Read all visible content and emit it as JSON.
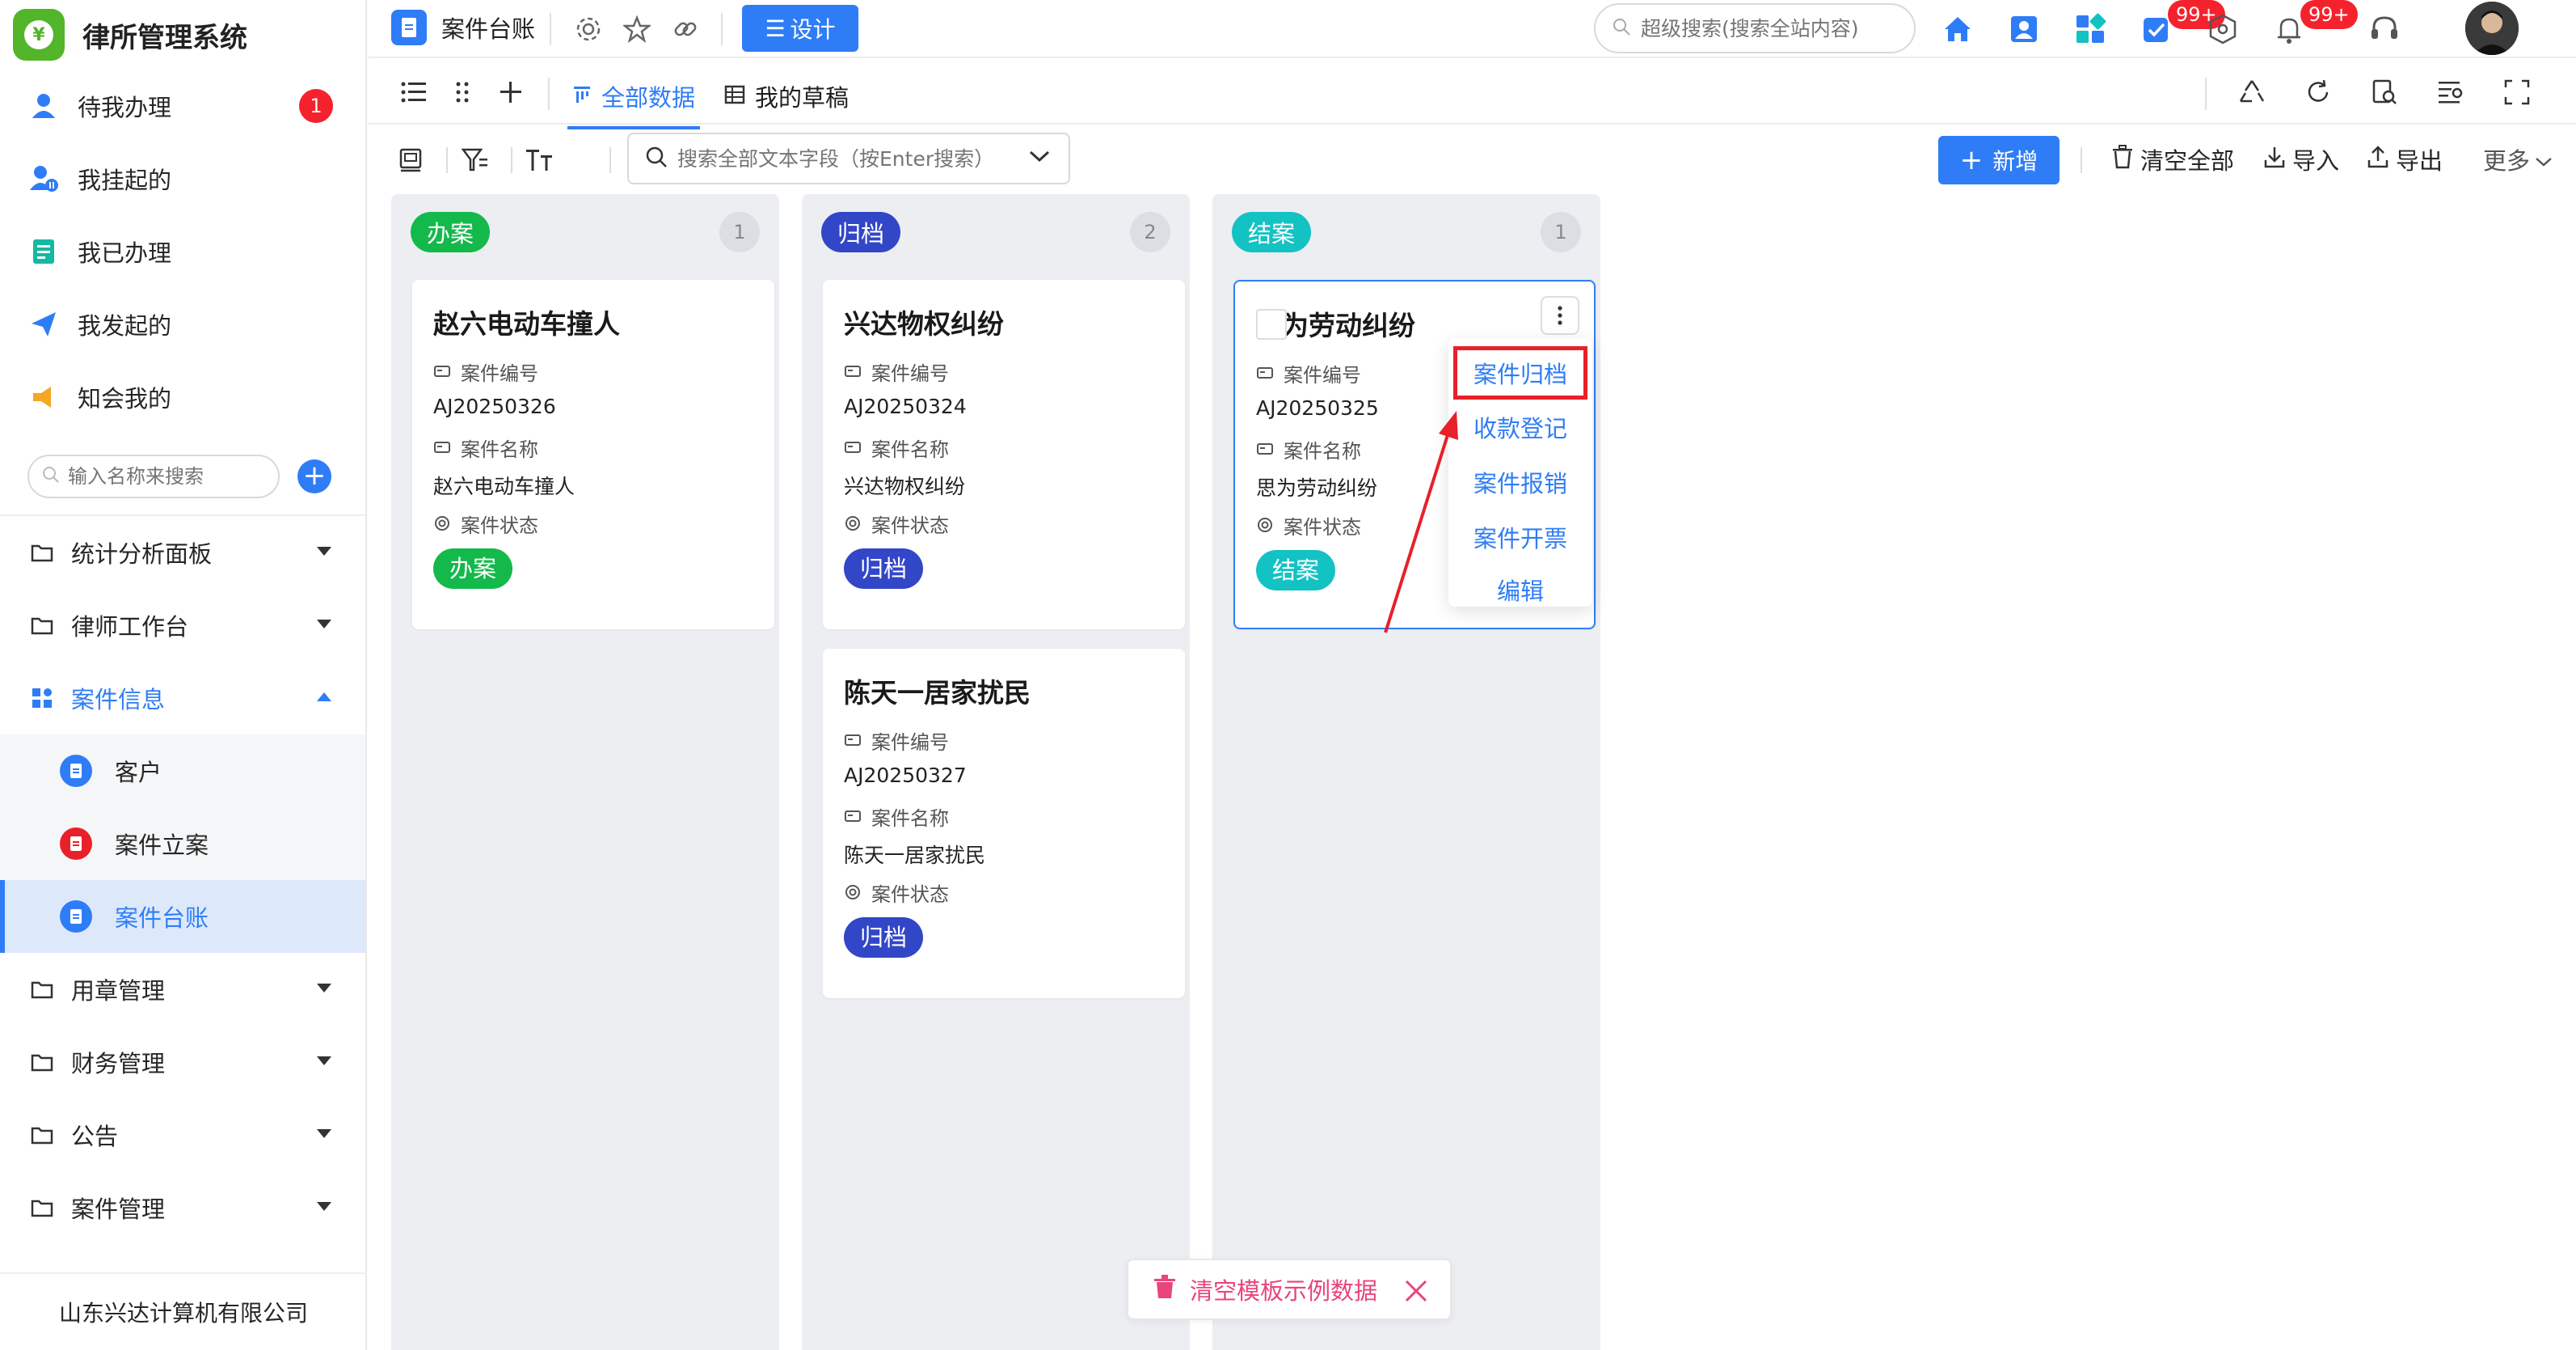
{
  "app": {
    "title": "律所管理系统",
    "company": "山东兴达计算机有限公司"
  },
  "sidebar": {
    "todo_items": [
      {
        "label": "待我办理",
        "icon": "user-task-icon",
        "badge": "1"
      },
      {
        "label": "我挂起的",
        "icon": "user-pause-icon"
      },
      {
        "label": "我已办理",
        "icon": "checklist-icon"
      },
      {
        "label": "我发起的",
        "icon": "paper-plane-icon"
      },
      {
        "label": "知会我的",
        "icon": "megaphone-icon"
      }
    ],
    "search_placeholder": "输入名称来搜索",
    "menus": [
      {
        "label": "统计分析面板",
        "icon": "folder-icon"
      },
      {
        "label": "律师工作台",
        "icon": "folder-icon"
      },
      {
        "label": "案件信息",
        "icon": "grid-icon",
        "expanded": true,
        "children": [
          {
            "label": "客户",
            "icon": "doc-blue-icon"
          },
          {
            "label": "案件立案",
            "icon": "doc-red-icon"
          },
          {
            "label": "案件台账",
            "icon": "doc-blue-icon",
            "active": true
          }
        ]
      },
      {
        "label": "用章管理",
        "icon": "folder-icon"
      },
      {
        "label": "财务管理",
        "icon": "folder-icon"
      },
      {
        "label": "公告",
        "icon": "folder-icon"
      },
      {
        "label": "案件管理",
        "icon": "folder-icon"
      }
    ]
  },
  "topbar": {
    "page_title": "案件台账",
    "design_label": "设计",
    "search_placeholder": "超级搜索(搜索全站内容)",
    "task_badge": "99+",
    "notify_badge": "99+"
  },
  "viewbar": {
    "tabs": [
      {
        "label": "全部数据",
        "active": true
      },
      {
        "label": "我的草稿",
        "active": false
      }
    ]
  },
  "toolbar": {
    "search_placeholder": "搜索全部文本字段（按Enter搜索）",
    "add_label": "新增",
    "clear_label": "清空全部",
    "import_label": "导入",
    "export_label": "导出",
    "more_label": "更多"
  },
  "colors": {
    "accent": "#2f7df6",
    "green": "#13b94a",
    "navy": "#3246c8",
    "teal": "#13c2c2",
    "red": "#e8202a"
  },
  "fields": {
    "case_no": "案件编号",
    "case_name": "案件名称",
    "case_status": "案件状态"
  },
  "columns": [
    {
      "tag": "办案",
      "count": "1",
      "color": "#13b94a",
      "cards": [
        {
          "title": "赵六电动车撞人",
          "case_no": "AJ20250326",
          "case_name": "赵六电动车撞人",
          "status": "办案"
        }
      ]
    },
    {
      "tag": "归档",
      "count": "2",
      "color": "#3246c8",
      "cards": [
        {
          "title": "兴达物权纠纷",
          "case_no": "AJ20250324",
          "case_name": "兴达物权纠纷",
          "status": "归档"
        },
        {
          "title": "陈天一居家扰民",
          "case_no": "AJ20250327",
          "case_name": "陈天一居家扰民",
          "status": "归档"
        }
      ]
    },
    {
      "tag": "结案",
      "count": "1",
      "color": "#13c2c2",
      "cards": [
        {
          "title": "为劳动纠纷",
          "case_no": "AJ20250325",
          "case_name": "思为劳动纠纷",
          "status": "结案"
        }
      ]
    }
  ],
  "dropdown": {
    "items": [
      "案件归档",
      "收款登记",
      "案件报销",
      "案件开票",
      "编辑"
    ]
  },
  "toast": {
    "label": "清空模板示例数据"
  }
}
